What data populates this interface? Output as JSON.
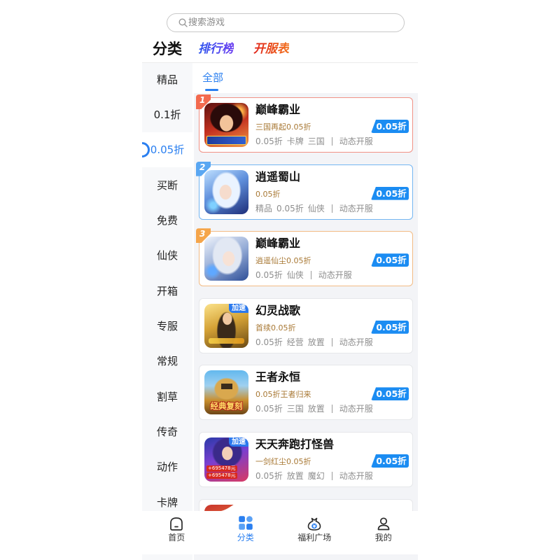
{
  "search": {
    "placeholder": "搜索游戏",
    "icon": "search-icon"
  },
  "header": {
    "category_title": "分类",
    "ranking_label": "排行榜",
    "server_list_label": "开服表"
  },
  "sidebar": {
    "items": [
      "精品",
      "0.1折",
      "0.05折",
      "买断",
      "免费",
      "仙侠",
      "开箱",
      "专服",
      "常规",
      "割草",
      "传奇",
      "动作",
      "卡牌"
    ],
    "selected_index": 2
  },
  "filter_tabs": {
    "items": [
      {
        "label": "全部",
        "active": true
      }
    ]
  },
  "games": [
    {
      "rank": "1",
      "rank_color": "#f36a4e",
      "border_color": "#f19185",
      "title": "巅峰霸业",
      "subtitle": "三国再起0.05折",
      "tags": [
        "0.05折",
        "卡牌",
        "三国"
      ],
      "server": "动态开服",
      "discount_badge": "0.05折"
    },
    {
      "rank": "2",
      "rank_color": "#5aa7f2",
      "border_color": "#74b6f2",
      "title": "逍遥蜀山",
      "subtitle": "0.05折",
      "tags": [
        "精品",
        "0.05折",
        "仙侠"
      ],
      "server": "动态开服",
      "discount_badge": "0.05折"
    },
    {
      "rank": "3",
      "rank_color": "#f5a54a",
      "border_color": "#f2bb84",
      "title": "巅峰霸业",
      "subtitle": "逍遥仙尘0.05折",
      "tags": [
        "0.05折",
        "仙侠"
      ],
      "server": "动态开服",
      "discount_badge": "0.05折"
    },
    {
      "title": "幻灵战歌",
      "subtitle": "首续0.05折",
      "tags": [
        "0.05折",
        "经营",
        "放置"
      ],
      "server": "动态开服",
      "discount_badge": "0.05折",
      "cover_badge": "加速"
    },
    {
      "title": "王者永恒",
      "subtitle": "0.05折王者归来",
      "tags": [
        "0.05折",
        "三国",
        "放置"
      ],
      "server": "动态开服",
      "discount_badge": "0.05折",
      "cover_caption": "经典复刻"
    },
    {
      "title": "天天奔跑打怪兽",
      "subtitle": "一剑红尘0.05折",
      "tags": [
        "0.05折",
        "放置",
        "魔幻"
      ],
      "server": "动态开服",
      "discount_badge": "0.05折",
      "cover_badge": "加速",
      "cover_prizes": [
        "+695478元",
        "+695478元"
      ]
    }
  ],
  "bottom_nav": {
    "items": [
      {
        "label": "首页",
        "icon": "home-icon"
      },
      {
        "label": "分类",
        "icon": "category-grid-icon",
        "active": true
      },
      {
        "label": "福利广场",
        "icon": "welfare-bag-icon",
        "icon_glyph": "¥"
      },
      {
        "label": "我的",
        "icon": "profile-icon"
      }
    ]
  },
  "colors": {
    "accent": "#2a7ff0",
    "badge": "#1b8cf2",
    "subtitle": "#a87834",
    "tag": "#8e8e8e",
    "card_border": "#e6e7ea",
    "list_background": "#f3f4f7",
    "sidebar_background": "#f7f8fa"
  }
}
